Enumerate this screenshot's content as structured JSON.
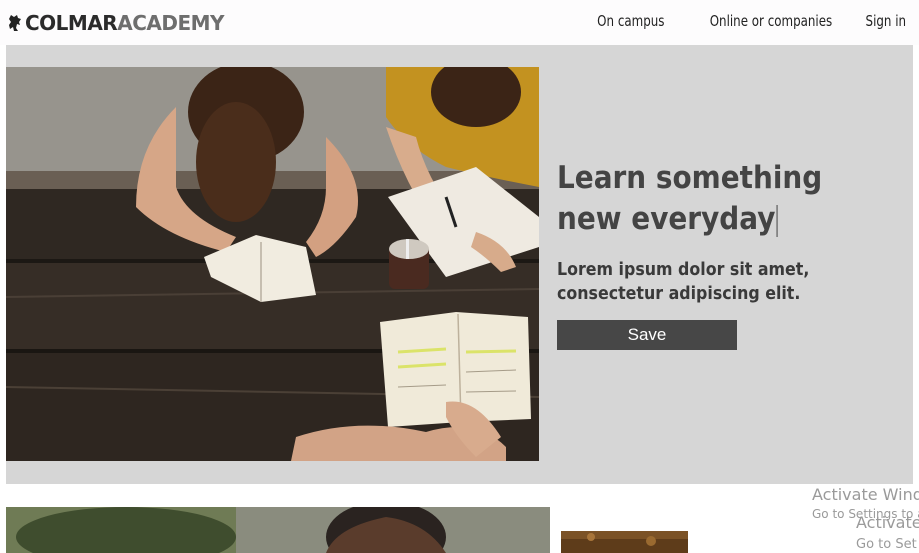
{
  "header": {
    "logo": {
      "part1": "COLMAR",
      "part2": "ACADEMY",
      "icon": "lion-icon"
    },
    "nav": [
      {
        "label": "On campus"
      },
      {
        "label": "Online or companies"
      },
      {
        "label": "Sign in"
      }
    ]
  },
  "hero": {
    "headline_line1": "Learn something",
    "headline_line2": "new everyday",
    "subtext_line1": "Lorem ipsum dolor sit amet,",
    "subtext_line2": "consectetur adipiscing elit.",
    "button_label": "Save"
  },
  "watermark": {
    "line1": "Activate Wind",
    "line2": "Go to Settings to a",
    "line3": "Activate",
    "line4": "Go to Set"
  },
  "colors": {
    "hero_bg": "#d6d6d6",
    "button_bg": "#474747",
    "headline": "#444444"
  }
}
